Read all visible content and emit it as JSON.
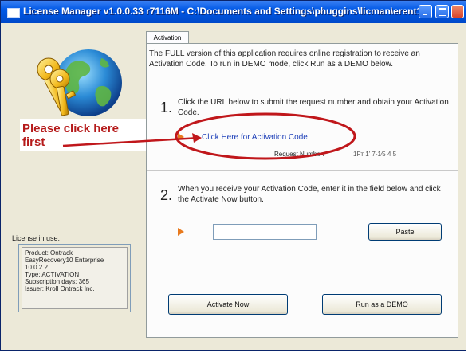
{
  "window": {
    "title": "License Manager v1.0.0.33 r7116M - C:\\Documents and Settings\\phuggins\\licman\\erent1000.lic"
  },
  "tabs": [
    {
      "label": "Activation"
    }
  ],
  "intro_text": "The FULL version of this application requires online registration to receive an Activation Code. To run in DEMO mode, click Run as a DEMO below.",
  "step1": {
    "number": "1.",
    "text": "Click the URL below to submit the request number and obtain your Activation Code.",
    "link_label": "Click Here for Activation Code",
    "request_label": "Request Number:",
    "request_value": "1Fт 1’ 7-1⁄5 4 5"
  },
  "step2": {
    "number": "2.",
    "text": "When you receive your Activation Code, enter it in the field below and click the Activate Now button.",
    "input_value": "",
    "paste_label": "Paste"
  },
  "buttons": {
    "activate_label": "Activate Now",
    "demo_label": "Run as a DEMO"
  },
  "license": {
    "label": "License in use:",
    "lines": [
      "Product: Ontrack",
      "EasyRecovery10 Enterprise",
      "10.0.2.2",
      "Type: ACTIVATION",
      "Subscription days: 365",
      "Issuer: Kroll Ontrack Inc."
    ]
  },
  "annotation": {
    "callout_line1": "Please click here",
    "callout_line2": "first",
    "color": "#c0171b"
  },
  "icons": {
    "app": "license-manager-icon",
    "art": "globe-with-keys-icon",
    "step_marker": "orange-triangle-icon"
  },
  "colors": {
    "titlebar": "#0058e6",
    "link": "#1d3fb8",
    "accent_arrow": "#e87a1e"
  }
}
